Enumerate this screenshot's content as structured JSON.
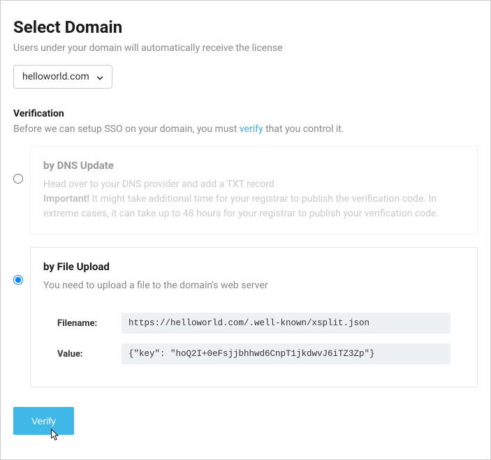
{
  "title": "Select Domain",
  "subtitle": "Users under your domain will automatically receive the license",
  "domain": {
    "selected": "helloworld.com"
  },
  "verification": {
    "heading": "Verification",
    "desc_before": "Before we can setup SSO on your domain, you must ",
    "verify_link": "verify",
    "desc_after": " that you control it."
  },
  "options": {
    "dns": {
      "title": "by DNS Update",
      "desc": "Head over to your DNS provider and add a TXT record",
      "important_label": "Important!",
      "important_text": " It might take additional time for your registrar to publish the verification code. In extreme cases, it can take up to 48 hours for your registrar to publish your verification code."
    },
    "file": {
      "title": "by File Upload",
      "desc": "You need to upload a file to the domain's web server",
      "filename_label": "Filename:",
      "filename_value": "https://helloworld.com/.well-known/xsplit.json",
      "value_label": "Value:",
      "value_value": "{\"key\": \"hoQ2I+0eFsjjbhhwd6CnpT1jkdwvJ6iTZ3Zp\"}"
    }
  },
  "buttons": {
    "verify": "Verify"
  }
}
